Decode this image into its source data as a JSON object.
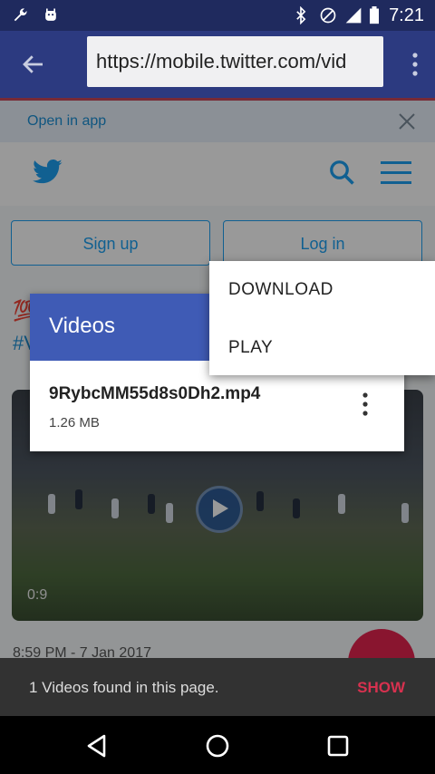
{
  "status_bar": {
    "time": "7:21",
    "icons": [
      "wrench-icon",
      "android-icon",
      "bluetooth-icon",
      "no-sim-icon",
      "signal-icon",
      "battery-icon"
    ]
  },
  "toolbar": {
    "url": "https://mobile.twitter.com/vid"
  },
  "page": {
    "open_in_app": "Open in app",
    "signup_label": "Sign up",
    "login_label": "Log in",
    "emoji_text": "💯",
    "hashtag_text": "#V",
    "video_duration": "0:9",
    "timestamp": "8:59 PM - 7 Jan 2017"
  },
  "dialog": {
    "title": "Videos",
    "file_name": "9RybcMM55d8s0Dh2.mp4",
    "file_size": "1.26 MB"
  },
  "popup": {
    "options": [
      "DOWNLOAD",
      "PLAY"
    ]
  },
  "snackbar": {
    "message": "1 Videos found in this page.",
    "action": "SHOW"
  },
  "colors": {
    "toolbar": "#2c3a80",
    "dialog_header": "#3f5bb5",
    "snack_action": "#d7314f",
    "twitter_blue": "#1da1f2"
  }
}
